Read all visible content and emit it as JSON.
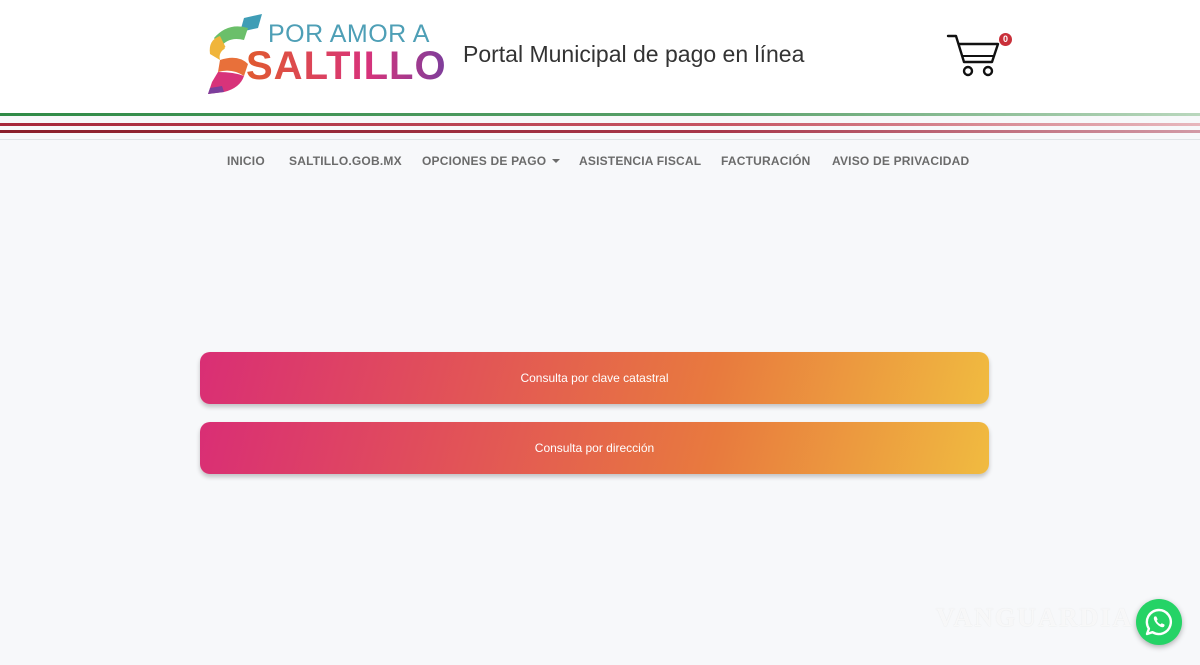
{
  "header": {
    "logo_top": "POR AMOR A",
    "logo_bottom": "SALTILLO",
    "title": "Portal Municipal de pago en línea",
    "cart_count": "0"
  },
  "nav": {
    "items": [
      {
        "label": "INICIO"
      },
      {
        "label": "SALTILLO.GOB.MX"
      },
      {
        "label": "OPCIONES DE PAGO"
      },
      {
        "label": "ASISTENCIA FISCAL"
      },
      {
        "label": "FACTURACIÓN"
      },
      {
        "label": "AVISO DE PRIVACIDAD"
      }
    ]
  },
  "main": {
    "buttons": [
      {
        "label": "Consulta por clave catastral"
      },
      {
        "label": "Consulta por dirección"
      }
    ]
  },
  "watermark": "VANGUARDIA",
  "colors": {
    "gradient_start": "#d92e75",
    "gradient_end": "#f0bb40",
    "stripe_green": "#2f8a46",
    "stripe_red": "#a6273a",
    "badge": "#c9303a",
    "whatsapp": "#25d366"
  },
  "icons": [
    "cart-icon",
    "chevron-down-icon",
    "whatsapp-icon"
  ]
}
